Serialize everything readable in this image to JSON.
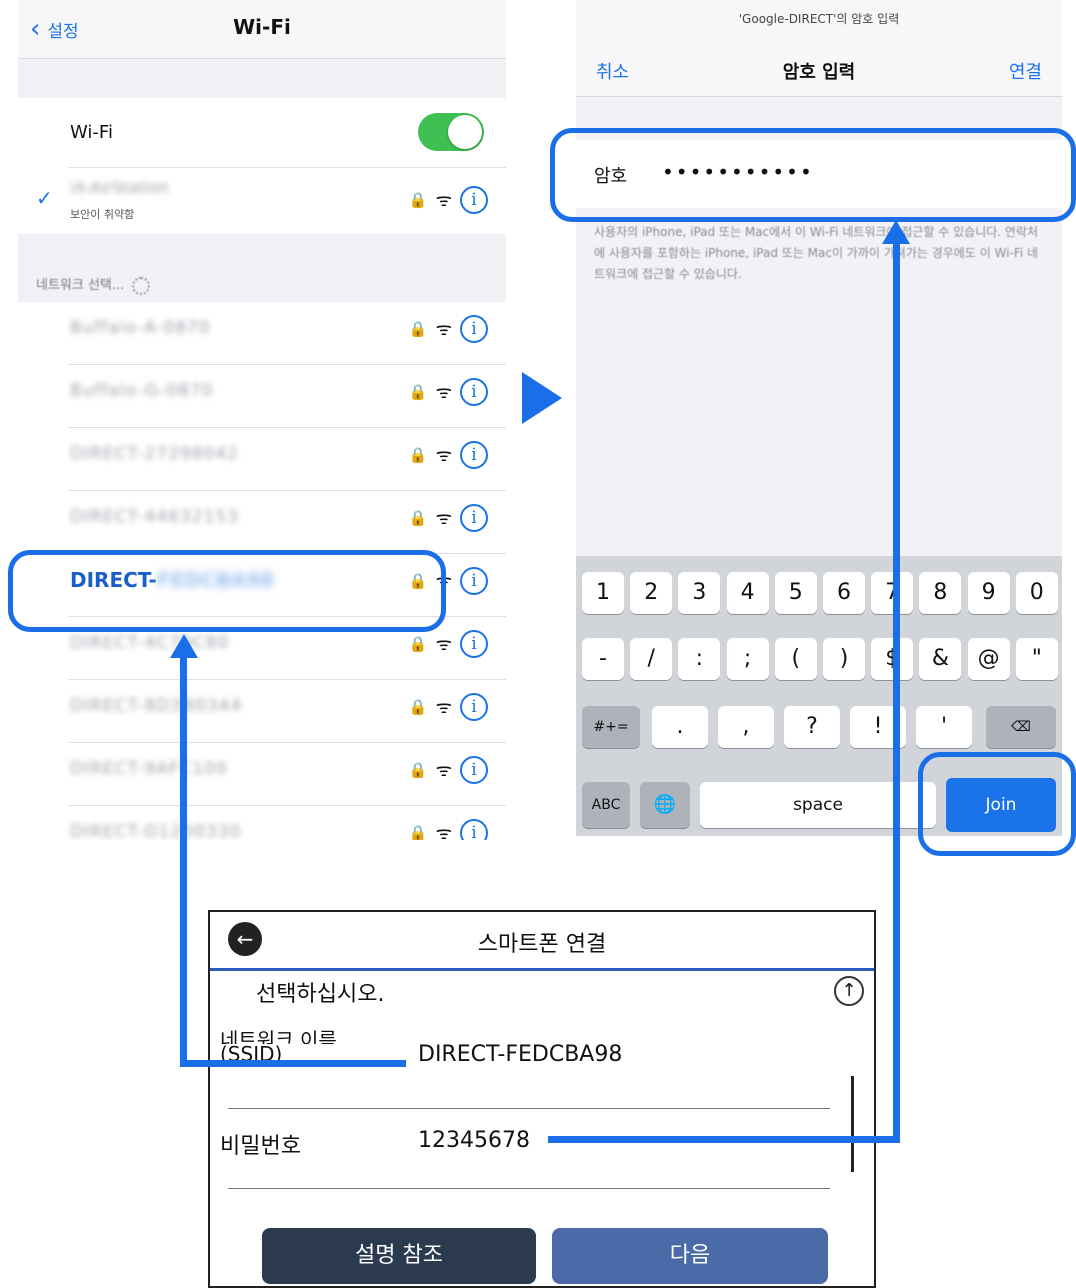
{
  "left_phone": {
    "back_label": "설정",
    "title": "Wi-Fi",
    "wifi_label": "Wi-Fi",
    "connected_name": "iX-AirStation",
    "connected_sub": "보안이 취약함",
    "section_header": "네트워크 선택...",
    "networks": [
      {
        "name": "Buffalo-A-0870"
      },
      {
        "name": "Buffalo-G-0870"
      },
      {
        "name": "DIRECT-27298042"
      },
      {
        "name": "DIRECT-44632153"
      },
      {
        "name": "DIRECT-FEDCBA98",
        "prefix": "DIRECT-",
        "blurred": "FEDCBA98",
        "highlighted": true
      },
      {
        "name": "DIRECT-4C79C80"
      },
      {
        "name": "DIRECT-8D3B0344"
      },
      {
        "name": "DIRECT-9AFC100"
      },
      {
        "name": "DIRECT-D1200330"
      }
    ]
  },
  "right_phone": {
    "network_prompt": "'Google-DIRECT'의 암호 입력",
    "cancel": "취소",
    "title": "암호 입력",
    "connect": "연결",
    "password_label": "암호",
    "password_value": "•••••••••••",
    "note": "사용자의 iPhone, iPad 또는 Mac에서 이 Wi-Fi 네트워크에 접근할 수 있습니다. 연락처에 사용자를 포함하는 iPhone, iPad 또는 Mac이 가까이 가져가는 경우에도 이 Wi-Fi 네트워크에 접근할 수 있습니다.",
    "keyboard": {
      "row1": [
        "1",
        "2",
        "3",
        "4",
        "5",
        "6",
        "7",
        "8",
        "9",
        "0"
      ],
      "row2": [
        "-",
        "/",
        ":",
        ";",
        "(",
        ")",
        "$",
        "&",
        "@",
        "\""
      ],
      "row3": [
        "#+=",
        ".",
        ",",
        "?",
        "!",
        "'",
        "⌫"
      ],
      "abc": "ABC",
      "globe": "🌐",
      "space": "space",
      "join": "Join"
    }
  },
  "printer": {
    "title": "스마트폰 연결",
    "instruction": "선택하십시오.",
    "ssid_label_top": "네트워크 이름",
    "ssid_label_bottom": "(SSID)",
    "ssid_value": "DIRECT-FEDCBA98",
    "password_label": "비밀번호",
    "password_value": "12345678",
    "btn_left": "설명 참조",
    "btn_right": "다음"
  },
  "colors": {
    "accent": "#1a6fe8",
    "toggle": "#3ec152",
    "join": "#1a73e8",
    "btn_left": "#2b3a4f",
    "btn_right": "#4a6aa8"
  }
}
